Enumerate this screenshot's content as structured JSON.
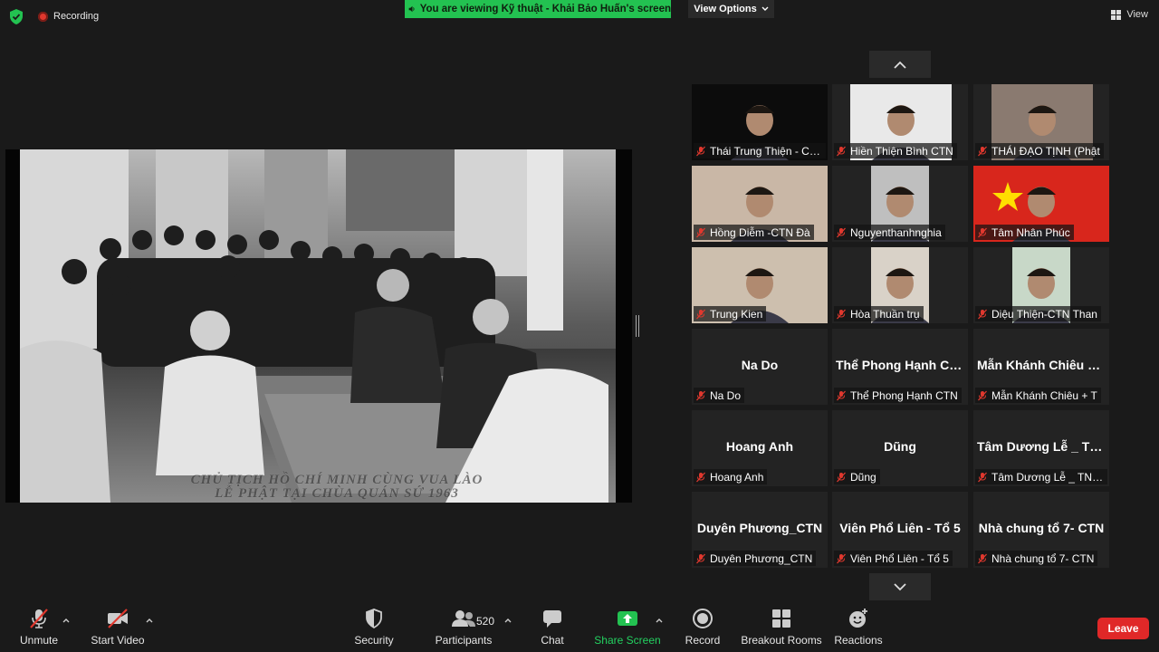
{
  "topbar": {
    "recording_label": "Recording",
    "viewing_banner": "You are viewing Kỹ thuật - Khải Bảo Huấn's screen",
    "view_options_label": "View Options",
    "view_label": "View"
  },
  "shared_screen": {
    "caption_line1": "CHỦ TỊCH HỒ CHÍ MINH CÙNG VUA LÀO",
    "caption_line2": "LỄ PHẬT TẠI CHÙA QUÁN SỨ 1963"
  },
  "participants": [
    {
      "name": "Thái Trung Thiện - CTN",
      "display_name": "",
      "muted": true,
      "video": true
    },
    {
      "name": "Hiền Thiện Bình  CTN",
      "display_name": "",
      "muted": true,
      "video": true
    },
    {
      "name": "THÁI ĐẠO TỊNH (Phật",
      "display_name": "",
      "muted": true,
      "video": true
    },
    {
      "name": "Hồng Diễm -CTN Đà",
      "display_name": "",
      "muted": true,
      "video": true
    },
    {
      "name": "Nguyenthanhnghia",
      "display_name": "",
      "muted": true,
      "video": true
    },
    {
      "name": "Tâm Nhân Phúc",
      "display_name": "",
      "muted": true,
      "video": true
    },
    {
      "name": "Trung Kien",
      "display_name": "",
      "muted": true,
      "video": true
    },
    {
      "name": "Hòa Thuần trụ",
      "display_name": "",
      "muted": true,
      "video": true
    },
    {
      "name": "Diệu Thiện-CTN Than",
      "display_name": "",
      "muted": true,
      "video": true
    },
    {
      "name": "Na Do",
      "display_name": "Na Do",
      "muted": true,
      "video": false
    },
    {
      "name": "Thể Phong Hạnh CTN",
      "display_name": "Thể Phong Hạnh CTN",
      "muted": true,
      "video": false
    },
    {
      "name": "Mẫn Khánh Chiêu + T",
      "display_name": "Mẫn Khánh Chiêu + T",
      "muted": true,
      "video": false
    },
    {
      "name": "Hoang Anh",
      "display_name": "Hoang Anh",
      "muted": true,
      "video": false
    },
    {
      "name": "Dũng",
      "display_name": "Dũng",
      "muted": true,
      "video": false
    },
    {
      "name": "Tâm Dương Lễ _ TNBG",
      "display_name": "Tâm Dương Lễ _ TNBG",
      "muted": true,
      "video": false
    },
    {
      "name": "Duyên Phương_CTN",
      "display_name": "Duyên  Phương_CTN",
      "muted": true,
      "video": false
    },
    {
      "name": "Viên Phổ Liên - Tổ 5",
      "display_name": "Viên Phổ Liên - Tổ 5",
      "muted": true,
      "video": false
    },
    {
      "name": "Nhà chung tổ 7- CTN",
      "display_name": "Nhà chung tổ 7- CTN",
      "muted": true,
      "video": false
    }
  ],
  "toolbar": {
    "unmute": "Unmute",
    "start_video": "Start Video",
    "security": "Security",
    "participants": "Participants",
    "participant_count": "520",
    "chat": "Chat",
    "share_screen": "Share Screen",
    "record": "Record",
    "breakout_rooms": "Breakout Rooms",
    "reactions": "Reactions",
    "leave": "Leave"
  },
  "colors": {
    "background": "#1a1a1a",
    "tile": "#232323",
    "share_green": "#23c251",
    "leave_red": "#e02828",
    "muted_red": "#e0382e"
  }
}
